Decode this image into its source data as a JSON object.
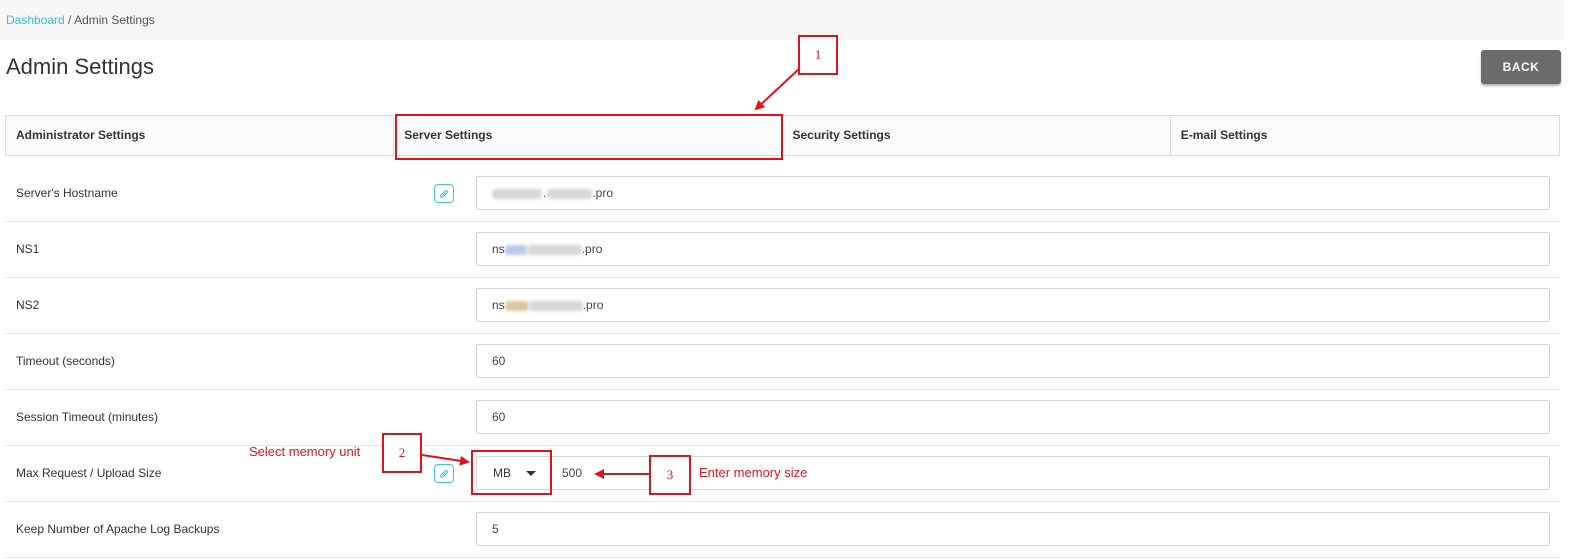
{
  "breadcrumb": {
    "link": "Dashboard",
    "separator": " / ",
    "current": "Admin Settings"
  },
  "page_title": "Admin Settings",
  "back_label": "BACK",
  "tabs": [
    {
      "label": "Administrator Settings"
    },
    {
      "label": "Server Settings"
    },
    {
      "label": "Security Settings"
    },
    {
      "label": "E-mail Settings"
    }
  ],
  "fields": {
    "hostname": {
      "label": "Server's Hostname",
      "value_suffix": ".pro"
    },
    "ns1": {
      "label": "NS1",
      "value_prefix": "ns",
      "value_suffix": ".pro"
    },
    "ns2": {
      "label": "NS2",
      "value_prefix": "ns",
      "value_suffix": ".pro"
    },
    "timeout": {
      "label": "Timeout (seconds)",
      "value": "60"
    },
    "session_timeout": {
      "label": "Session Timeout (minutes)",
      "value": "60"
    },
    "max_request": {
      "label": "Max Request / Upload Size",
      "unit": "MB",
      "value": "500"
    },
    "log_backups": {
      "label": "Keep Number of Apache Log Backups",
      "value": "5"
    }
  },
  "annotations": {
    "n1": "1",
    "n2": "2",
    "n3": "3",
    "select_memory_unit": "Select memory unit",
    "enter_memory_size": "Enter memory size",
    "color": "#e0131d"
  },
  "icons": {
    "link": "link-icon",
    "caret": "caret-down-icon"
  }
}
